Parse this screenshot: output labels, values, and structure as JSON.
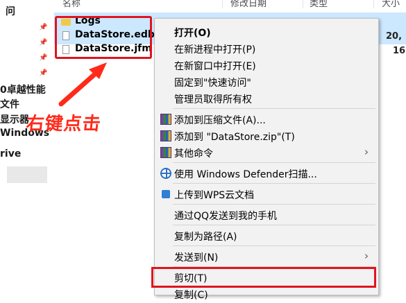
{
  "columns": [
    "名称",
    "修改日期",
    "类型",
    "大小"
  ],
  "left_nav": {
    "items": [
      "问",
      "0卓越性能",
      "文件",
      "显示器",
      "Windows",
      "rive"
    ]
  },
  "files": [
    {
      "name": "Logs",
      "kind": "folder"
    },
    {
      "name": "DataStore.edb",
      "kind": "file",
      "size": "20,"
    },
    {
      "name": "DataStore.jfm",
      "kind": "file",
      "size": "16"
    }
  ],
  "annotation": "右键点击",
  "context_menu": {
    "items": [
      {
        "label": "打开(O)",
        "icon": "",
        "bold": true
      },
      {
        "label": "在新进程中打开(P)",
        "icon": ""
      },
      {
        "label": "在新窗口中打开(E)",
        "icon": ""
      },
      {
        "label": "固定到\"快速访问\"",
        "icon": ""
      },
      {
        "label": "管理员取得所有权",
        "icon": ""
      },
      {
        "label": "添加到压缩文件(A)...",
        "icon": "winrar-icon"
      },
      {
        "label": "添加到 \"DataStore.zip\"(T)",
        "icon": "winrar-icon"
      },
      {
        "label": "其他命令",
        "icon": "winrar-icon",
        "submenu": true
      },
      {
        "label": "使用 Windows Defender扫描...",
        "icon": "defender-icon"
      },
      {
        "label": "上传到WPS云文档",
        "icon": "wps-cloud-icon"
      },
      {
        "label": "通过QQ发送到我的手机",
        "icon": ""
      },
      {
        "label": "复制为路径(A)",
        "icon": ""
      },
      {
        "label": "发送到(N)",
        "icon": "",
        "submenu": true
      },
      {
        "label": "剪切(T)",
        "icon": ""
      },
      {
        "label": "复制(C)",
        "icon": ""
      }
    ]
  },
  "colors": {
    "highlight_red": "#e0141e",
    "annotation_red": "#ff2a1a",
    "selection_blue": "#cce8ff",
    "menu_bg": "#f2f2f2"
  }
}
